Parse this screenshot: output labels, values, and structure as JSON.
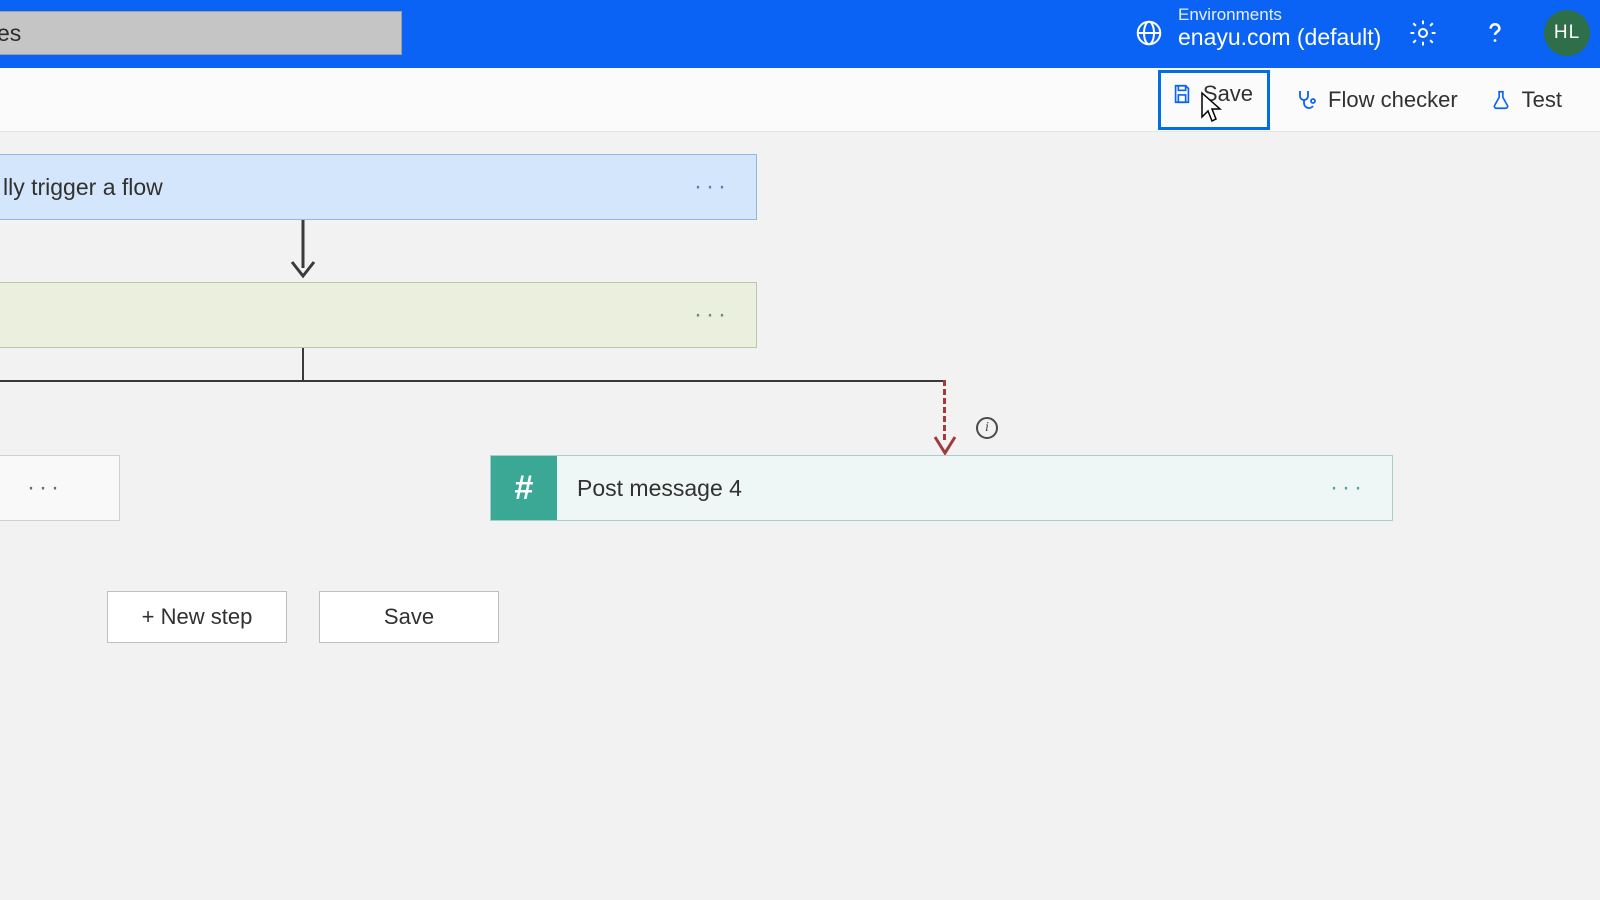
{
  "header": {
    "search_value": "es",
    "env_label": "Environments",
    "env_name": "enayu.com (default)",
    "avatar_initials": "HL"
  },
  "commands": {
    "save": "Save",
    "flow_checker": "Flow checker",
    "test": "Test"
  },
  "flow": {
    "trigger_label": "lly trigger a flow",
    "step2_label": "",
    "post_label": "Post message 4"
  },
  "buttons": {
    "new_step": "+ New step",
    "save": "Save"
  },
  "colors": {
    "brand": "#0b63f5",
    "focus": "#006ee5",
    "dashed": "#a23b3b",
    "teal": "#3aa894"
  }
}
